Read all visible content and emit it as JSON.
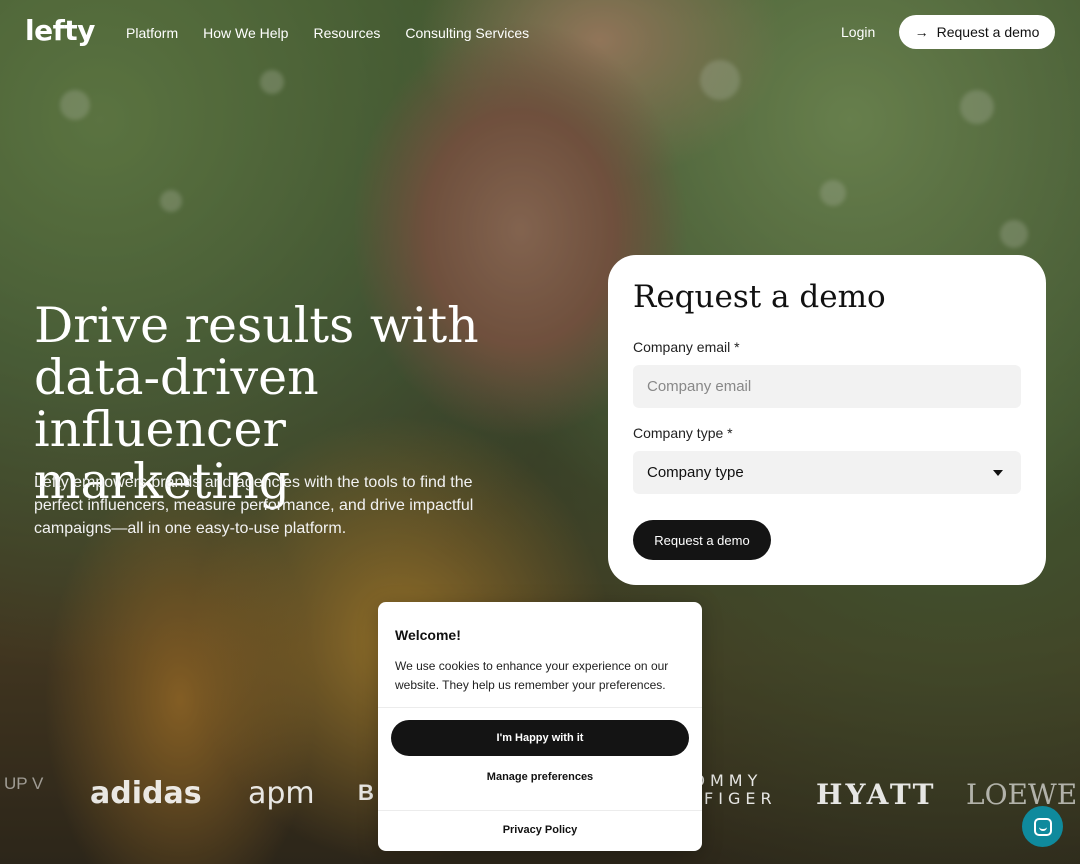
{
  "nav": {
    "logo": "lefty",
    "links": [
      "Platform",
      "How We Help",
      "Resources",
      "Consulting Services"
    ],
    "login": "Login",
    "demo_label": "Request a demo"
  },
  "hero": {
    "title": "Drive results with data-driven influencer marketing",
    "subtitle": "Lefty empowers brands and agencies with the tools to find the perfect influencers, measure performance, and drive impactful campaigns—all in one easy-to-use platform."
  },
  "form": {
    "title": "Request a demo",
    "email_label": "Company email *",
    "email_placeholder": "Company email",
    "type_label": "Company type *",
    "type_value": "Company type",
    "submit_label": "Request a demo"
  },
  "logos": [
    "UP VER",
    "adidas",
    "apm",
    "B",
    "TOMMY HILFIGER",
    "HYATT",
    "LOEWE"
  ],
  "cookie": {
    "title": "Welcome!",
    "text": "We use cookies to enhance your experience on our website. They help us remember your preferences.",
    "accept_label": "I'm Happy with it",
    "manage_label": "Manage preferences",
    "policy_label": "Privacy Policy"
  },
  "icons": {
    "nav_demo": "arrow-right-icon",
    "select": "caret-down-icon",
    "chat": "chat-icon"
  },
  "colors": {
    "dark_button": "#141414",
    "chat_bubble": "#0f8a9d"
  }
}
